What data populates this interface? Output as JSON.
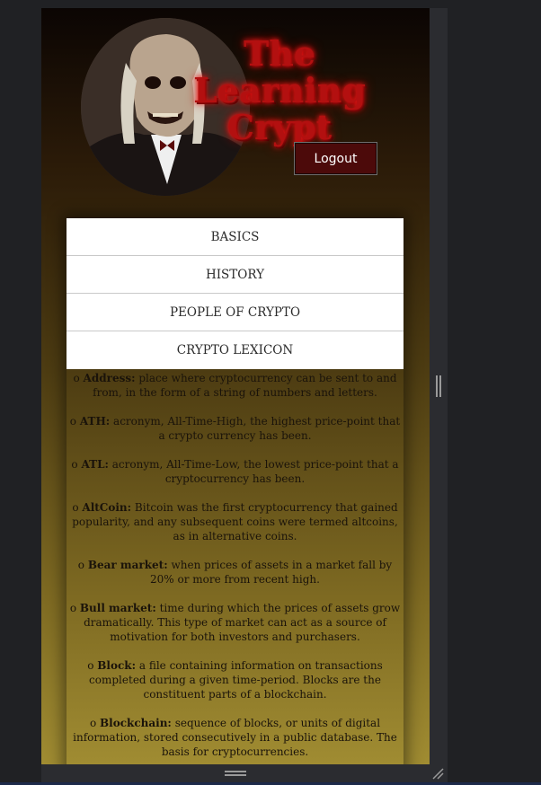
{
  "header": {
    "logo_title_lines": [
      "The",
      "Learning",
      "Crypt"
    ],
    "logout_label": "Logout"
  },
  "nav": {
    "items": [
      "BASICS",
      "HISTORY",
      "PEOPLE OF CRYPTO",
      "CRYPTO LEXICON"
    ]
  },
  "lexicon": {
    "bullet": "o",
    "entries": [
      {
        "term": "Address:",
        "definition": "place where cryptocurrency can be sent to and from, in the form of a string of numbers and letters."
      },
      {
        "term": "ATH:",
        "definition": "acronym, All-Time-High, the highest price-point that a crypto currency has been."
      },
      {
        "term": "ATL:",
        "definition": "acronym, All-Time-Low, the lowest price-point that a cryptocurrency has been."
      },
      {
        "term": "AltCoin:",
        "definition": "Bitcoin was the first cryptocurrency that gained popularity, and any subsequent coins were termed altcoins, as in alternative coins."
      },
      {
        "term": "Bear market:",
        "definition": "when prices of assets in a market fall by 20% or more from recent high."
      },
      {
        "term": "Bull market:",
        "definition": "time during which the prices of assets grow dramatically. This type of market can act as a source of motivation for both investors and purchasers."
      },
      {
        "term": "Block:",
        "definition": "a file containing information on transactions completed during a given time-period. Blocks are the constituent parts of a blockchain."
      },
      {
        "term": "Blockchain:",
        "definition": "sequence of blocks, or units of digital information, stored consecutively in a public database. The basis for cryptocurrencies."
      }
    ]
  },
  "icons": {
    "scroll_grip": "vertical-grip-icon",
    "bottom_grip": "horizontal-grip-icon",
    "resize": "resize-handle-icon"
  },
  "colors": {
    "logout_background": "#4c0a0a",
    "logo_title": "#b31010"
  }
}
